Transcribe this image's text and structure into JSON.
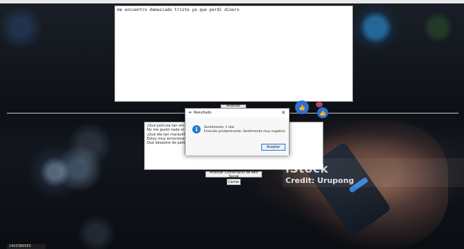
{
  "main_window": {
    "input_text": "me encuentro demasiado triste ya que perdi dinero",
    "analyze_phrase_button": "Analizar Frase",
    "comments_text": "¡Qué película tan emocio\nNo me gustó nada el ser\n¡Qué día tan maravilloso!\nEstoy muy emocionado p\nQué desastre de película,",
    "analyze_social_button": "Analizar Comentario de Red Social",
    "close_button": "Cerrar"
  },
  "dialog": {
    "title": "Resultado",
    "close_glyph": "✕",
    "sentiment_line": "Sentimiento: 1 star",
    "emotion_line": "Emoción predominante: Sentimiento muy negativo",
    "ok_button": "Aceptar",
    "icon": "info-icon"
  },
  "background": {
    "watermark_brand": "iStock",
    "watermark_credit": "Credit: Urupong",
    "image_id_tag": "1403380583"
  },
  "colors": {
    "accent": "#1f78d1",
    "like_icon": "#2f6fd1"
  }
}
